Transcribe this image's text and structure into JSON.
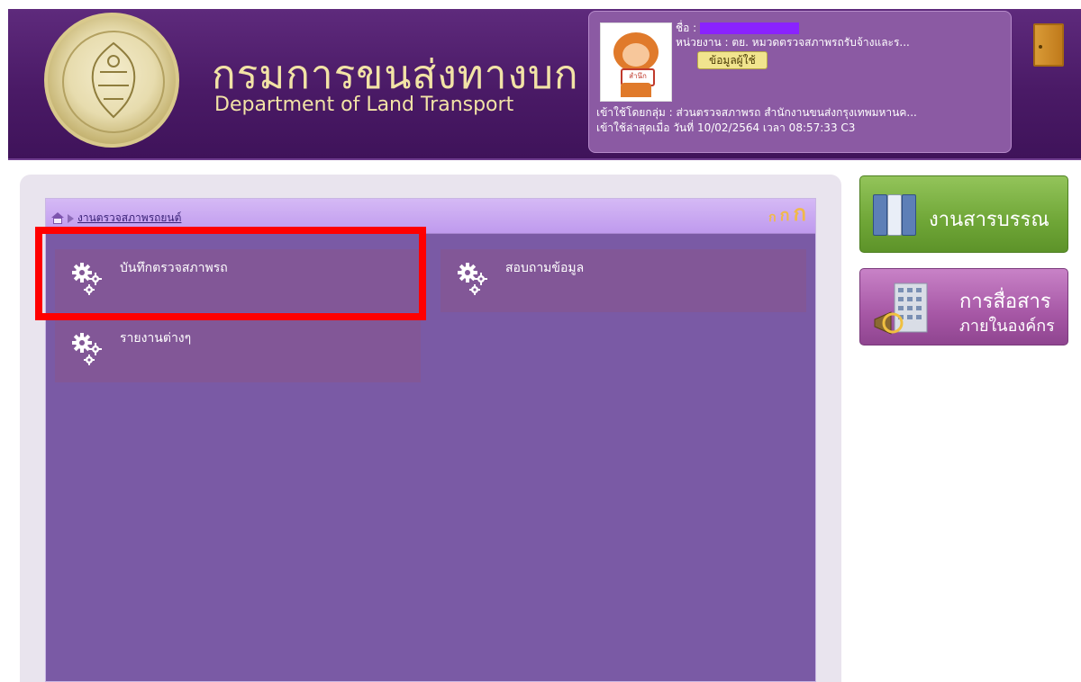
{
  "header": {
    "org_name_th": "กรมการขนส่งทางบก",
    "org_name_en": "Department of Land Transport",
    "user": {
      "name_label": "ชื่อ :",
      "unit_label": "หน่วยงาน : ตย. หมวดตรวจสภาพรถรับจ้างและร...",
      "user_info_button": "ข้อมูลผู้ใช้",
      "group_line": "เข้าใช้โดยกลุ่ม : ส่วนตรวจสภาพรถ สำนักงานขนส่งกรุงเทพมหานค...",
      "last_login_line": "เข้าใช้ล่าสุดเมื่อ วันที่ 10/02/2564 เวลา 08:57:33 C3",
      "avatar_sign": "สำนึก"
    }
  },
  "module": {
    "breadcrumb_label": "งานตรวจสภาพรถยนต์",
    "font_controls": [
      "ก",
      "ก",
      "ก"
    ],
    "menu_items": [
      {
        "label": "บันทึกตรวจสภาพรถ"
      },
      {
        "label": "สอบถามข้อมูล"
      },
      {
        "label": "รายงานต่างๆ"
      }
    ]
  },
  "side": {
    "saraban": "งานสารบรรณ",
    "comm_main": "การสื่อสาร",
    "comm_sub": "ภายในองค์กร"
  },
  "colors": {
    "header_bg": "#4a1a66",
    "panel_bg": "#7a5aa5",
    "highlight": "#ff0000"
  }
}
